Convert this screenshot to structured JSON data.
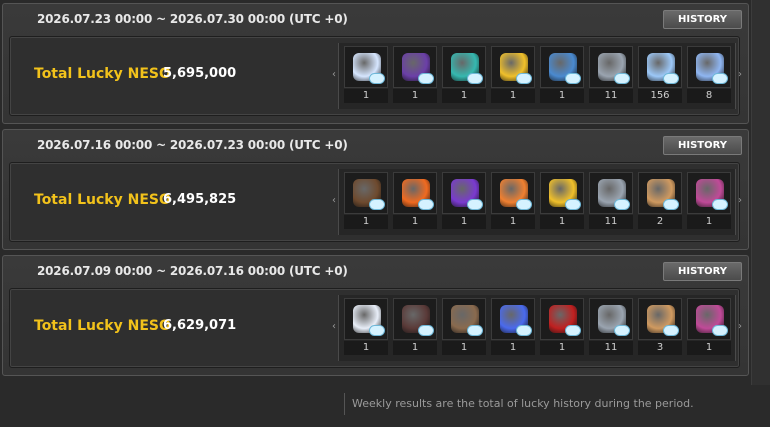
{
  "panels": [
    {
      "period": "2026.07.23 00:00 ~ 2026.07.30 00:00 (UTC +0)",
      "history_label": "HISTORY",
      "total_label": "Total Lucky NESO",
      "total_value": "5,695,000",
      "items": [
        {
          "icon": "rabbit-costume-icon",
          "count": "1",
          "color": "#d6e6ff"
        },
        {
          "icon": "purple-pendant-icon",
          "count": "1",
          "color": "#6b3fa8"
        },
        {
          "icon": "teal-ticket-icon",
          "count": "1",
          "color": "#35b8b0"
        },
        {
          "icon": "gold-ticket-icon",
          "count": "1",
          "color": "#f0c02a"
        },
        {
          "icon": "blue-gear-icon",
          "count": "1",
          "color": "#4a8ad0"
        },
        {
          "icon": "lock-box-icon",
          "count": "11",
          "color": "#9aa4b0"
        },
        {
          "icon": "star-crystal-icon",
          "count": "156",
          "color": "#9cc8f8"
        },
        {
          "icon": "star-crystal-large-icon",
          "count": "8",
          "color": "#8fb6f2"
        }
      ]
    },
    {
      "period": "2026.07.16 00:00 ~ 2026.07.23 00:00 (UTC +0)",
      "history_label": "HISTORY",
      "total_label": "Total Lucky NESO",
      "total_value": "6,495,825",
      "items": [
        {
          "icon": "brown-bag-icon",
          "count": "1",
          "color": "#6e4a2e"
        },
        {
          "icon": "orange-ticket-icon",
          "count": "1",
          "color": "#f06a20"
        },
        {
          "icon": "purple-ticket-icon",
          "count": "1",
          "color": "#7a3ad0"
        },
        {
          "icon": "orange-ticket-icon",
          "count": "1",
          "color": "#f08030"
        },
        {
          "icon": "gold-ticket-icon",
          "count": "1",
          "color": "#f0c02a"
        },
        {
          "icon": "lock-box-icon",
          "count": "11",
          "color": "#9aa4b0"
        },
        {
          "icon": "compass-orb-icon",
          "count": "2",
          "color": "#d09a60"
        },
        {
          "icon": "pink-orb-icon",
          "count": "1",
          "color": "#c04a98"
        }
      ]
    },
    {
      "period": "2026.07.09 00:00 ~ 2026.07.16 00:00 (UTC +0)",
      "history_label": "HISTORY",
      "total_label": "Total Lucky NESO",
      "total_value": "6,629,071",
      "items": [
        {
          "icon": "bunny-hat-icon",
          "count": "1",
          "color": "#e8eef8"
        },
        {
          "icon": "dark-armor-icon",
          "count": "1",
          "color": "#5a3a38"
        },
        {
          "icon": "brown-glove-icon",
          "count": "1",
          "color": "#8a6a4e"
        },
        {
          "icon": "blue-spirit-icon",
          "count": "1",
          "color": "#4a6aee"
        },
        {
          "icon": "red-gem-icon",
          "count": "1",
          "color": "#c02020"
        },
        {
          "icon": "lock-box-icon",
          "count": "11",
          "color": "#9aa4b0"
        },
        {
          "icon": "compass-orb-icon",
          "count": "3",
          "color": "#d09a60"
        },
        {
          "icon": "pink-orb-icon",
          "count": "1",
          "color": "#c04a98"
        }
      ]
    }
  ],
  "footer_text": "Weekly results are the total of lucky history during the period."
}
